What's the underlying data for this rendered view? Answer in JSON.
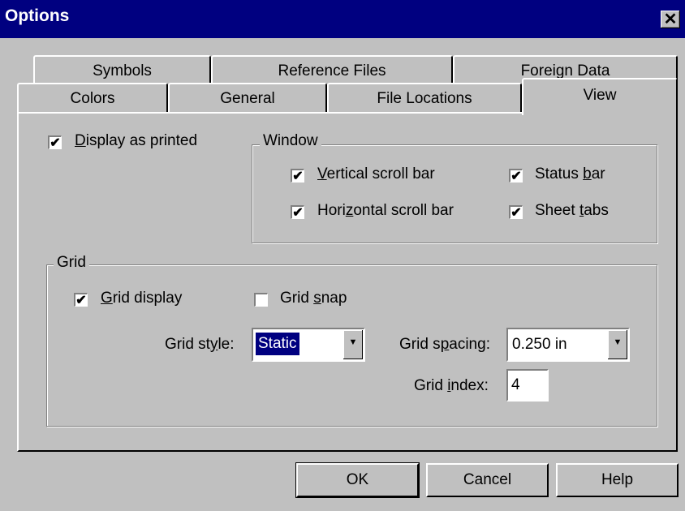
{
  "window": {
    "title": "Options",
    "close_icon": "close-icon"
  },
  "tabs": {
    "row1": [
      {
        "label": "Symbols"
      },
      {
        "label": "Reference Files"
      },
      {
        "label": "Foreign Data"
      }
    ],
    "row2": [
      {
        "label": "Colors"
      },
      {
        "label": "General"
      },
      {
        "label": "File Locations"
      },
      {
        "label": "View",
        "active": true
      }
    ]
  },
  "view": {
    "display_as_printed": {
      "label_pre": "",
      "accel": "D",
      "label_post": "isplay as printed",
      "checked": true
    },
    "window_group": {
      "title": "Window",
      "vertical_scroll_bar": {
        "accel": "V",
        "label_post": "ertical scroll bar",
        "checked": true
      },
      "horizontal_scroll_bar": {
        "label_pre": "Hori",
        "accel": "z",
        "label_post": "ontal scroll bar",
        "checked": true
      },
      "status_bar": {
        "label_pre": "Status ",
        "accel": "b",
        "label_post": "ar",
        "checked": true
      },
      "sheet_tabs": {
        "label_pre": "Sheet ",
        "accel": "t",
        "label_post": "abs",
        "checked": true
      }
    },
    "grid_group": {
      "title": "Grid",
      "grid_display": {
        "accel": "G",
        "label_post": "rid display",
        "checked": true
      },
      "grid_snap": {
        "label_pre": "Grid ",
        "accel": "s",
        "label_post": "nap",
        "checked": false
      },
      "grid_style": {
        "label_pre": "Grid st",
        "accel": "y",
        "label_post": "le:",
        "value": "Static"
      },
      "grid_spacing": {
        "label_pre": "Grid s",
        "accel": "p",
        "label_post": "acing:",
        "value": "0.250 in"
      },
      "grid_index": {
        "label_pre": "Grid ",
        "accel": "i",
        "label_post": "ndex:",
        "value": "4"
      }
    }
  },
  "buttons": {
    "ok": "OK",
    "cancel": "Cancel",
    "help": "Help"
  },
  "checkmark": "✔",
  "dropdown_arrow": "▼"
}
